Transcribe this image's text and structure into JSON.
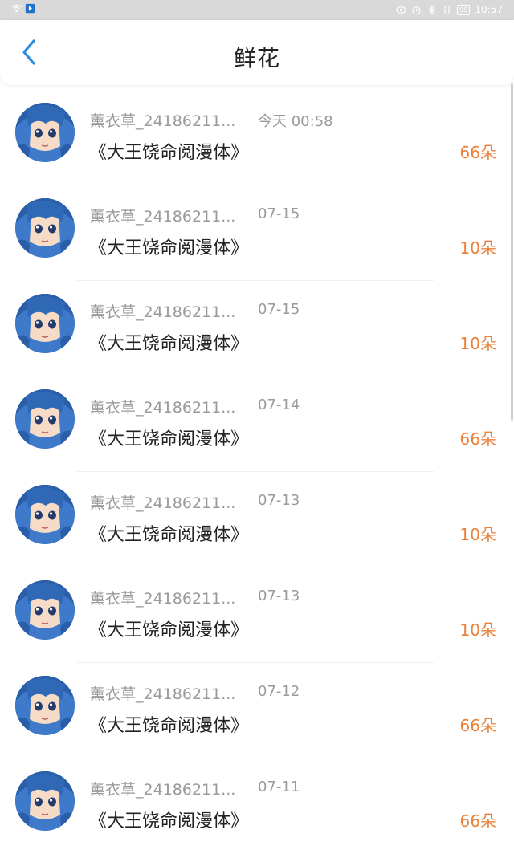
{
  "statusbar": {
    "time": "10:57",
    "battery": "99"
  },
  "header": {
    "title": "鲜花"
  },
  "items": [
    {
      "name": "薰衣草_24186211...",
      "time": "今天 00:58",
      "book": "《大王饶命阅漫体》",
      "count": "66朵"
    },
    {
      "name": "薰衣草_24186211...",
      "time": "07-15",
      "book": "《大王饶命阅漫体》",
      "count": "10朵"
    },
    {
      "name": "薰衣草_24186211...",
      "time": "07-15",
      "book": "《大王饶命阅漫体》",
      "count": "10朵"
    },
    {
      "name": "薰衣草_24186211...",
      "time": "07-14",
      "book": "《大王饶命阅漫体》",
      "count": "66朵"
    },
    {
      "name": "薰衣草_24186211...",
      "time": "07-13",
      "book": "《大王饶命阅漫体》",
      "count": "10朵"
    },
    {
      "name": "薰衣草_24186211...",
      "time": "07-13",
      "book": "《大王饶命阅漫体》",
      "count": "10朵"
    },
    {
      "name": "薰衣草_24186211...",
      "time": "07-12",
      "book": "《大王饶命阅漫体》",
      "count": "66朵"
    },
    {
      "name": "薰衣草_24186211...",
      "time": "07-11",
      "book": "《大王饶命阅漫体》",
      "count": "66朵"
    }
  ],
  "colors": {
    "accent": "#2b8ce0",
    "count": "#e9813a",
    "muted": "#9a9a9a"
  }
}
